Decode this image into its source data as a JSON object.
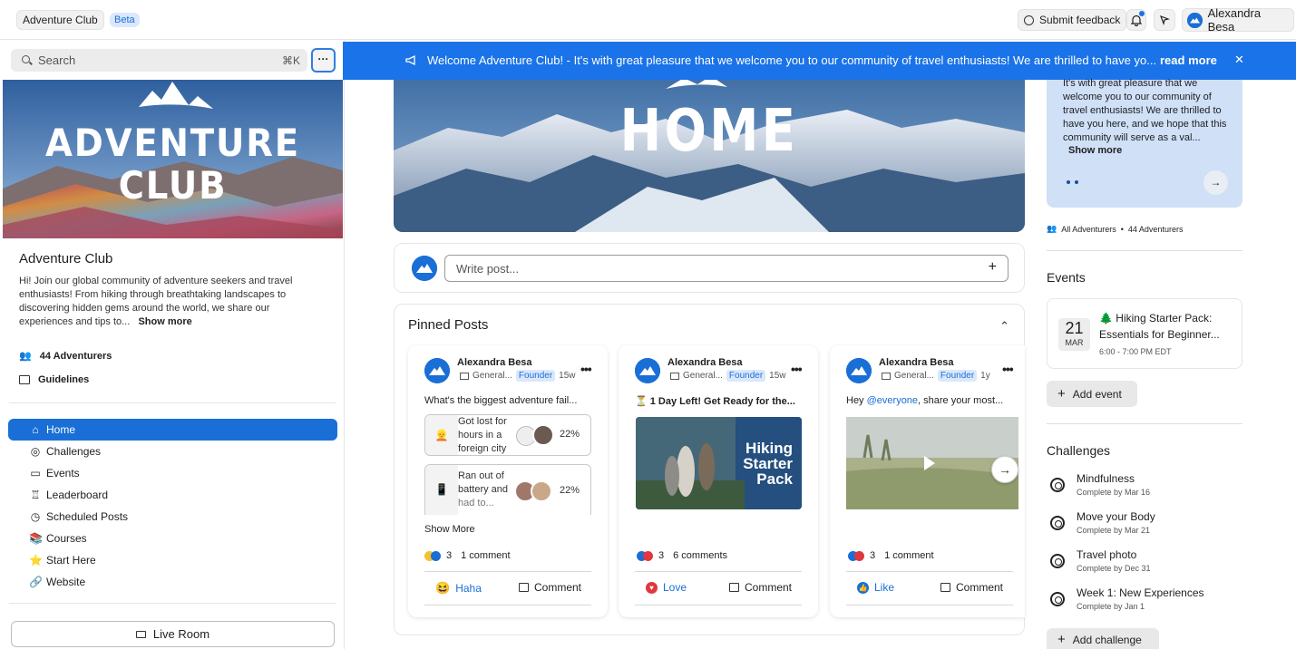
{
  "topbar": {
    "community": "Adventure Club",
    "beta": "Beta",
    "feedback": "Submit feedback",
    "user": "Alexandra Besa"
  },
  "sidebar": {
    "search_placeholder": "Search",
    "shortcut": "⌘K",
    "more": "···",
    "banner": {
      "line1": "ADVENTURE",
      "line2": "CLUB"
    },
    "title": "Adventure Club",
    "desc": "Hi! Join our global community of adventure seekers and travel enthusiasts! From hiking through breathtaking landscapes to discovering hidden gems around the world, we share our experiences and tips to...",
    "desc_l1": "Hi! Join our global community of adventure seekers and travel",
    "desc_l2": "enthusiasts! From hiking through breathtaking landscapes to",
    "desc_l3": "discovering hidden gems around the world, we share our",
    "desc_l4": "experiences and tips to...",
    "show_more": "Show more",
    "members": "44 Adventurers",
    "guidelines": "Guidelines",
    "nav": [
      {
        "label": "Home",
        "icon": "home-icon"
      },
      {
        "label": "Challenges",
        "icon": "target-icon"
      },
      {
        "label": "Events",
        "icon": "calendar-icon"
      },
      {
        "label": "Leaderboard",
        "icon": "trophy-icon"
      },
      {
        "label": "Scheduled Posts",
        "icon": "clock-icon"
      },
      {
        "label": "Courses",
        "icon": "books-icon"
      },
      {
        "label": "Start Here",
        "icon": "star-icon"
      },
      {
        "label": "Website",
        "icon": "link-icon"
      }
    ],
    "live_room": "Live Room"
  },
  "announcement": {
    "icon": "megaphone-icon",
    "text": "Welcome Adventure Club! - It's with great pleasure that we welcome you to our community of travel enthusiasts! We are thrilled to have yo...",
    "read_more": "read more",
    "close": "✕"
  },
  "hero": {
    "title": "HOME"
  },
  "composer": {
    "placeholder": "Write post...",
    "plus": "+"
  },
  "pinned": {
    "title": "Pinned Posts",
    "chevron": "⌃",
    "show_more": "Show More",
    "posts": [
      {
        "author": "Alexandra Besa",
        "space": "General...",
        "badge": "Founder",
        "age": "15w",
        "text": "What's the biggest adventure fail...",
        "options": [
          {
            "text": "Got lost for hours in a foreign city",
            "l1": "Got lost for",
            "l2": "hours in a",
            "l3": "foreign city",
            "pct": "22%",
            "emoji": "👱"
          },
          {
            "text": "Ran out of battery and had to...",
            "l1": "Ran out of",
            "l2": "battery and",
            "l3": "had to...",
            "pct": "22%",
            "emoji": "📱"
          }
        ],
        "reactions": "3",
        "comments": "1 comment",
        "action1": "Haha",
        "action2": "Comment"
      },
      {
        "author": "Alexandra Besa",
        "space": "General...",
        "badge": "Founder",
        "age": "15w",
        "text": "⏳ 1 Day Left! Get Ready for the...",
        "image_text": "Hiking Starter Pack",
        "img_l1": "Hiking",
        "img_l2": "Starter",
        "img_l3": "Pack",
        "reactions": "3",
        "comments": "6 comments",
        "action1": "Love",
        "action2": "Comment"
      },
      {
        "author": "Alexandra Besa",
        "space": "General...",
        "badge": "Founder",
        "age": "1y",
        "text_pre": "Hey ",
        "mention": "@everyone",
        "text_post": ", share your most...",
        "reactions": "3",
        "comments": "1 comment",
        "action1": "Like",
        "action2": "Comment"
      }
    ]
  },
  "right": {
    "about_l1": "It's with great pleasure that we",
    "about_l2": "welcome you to our community of",
    "about_l3": "travel enthusiasts! We are thrilled to",
    "about_l4": "have you here, and we hope that this",
    "about_l5": "community will serve as a val...",
    "about_show_more": "Show more",
    "members_all": "All Adventurers",
    "members_count": "44 Adventurers",
    "events_title": "Events",
    "event": {
      "day": "21",
      "month": "MAR",
      "title_l1": "🌲 Hiking Starter Pack:",
      "title_l2": "Essentials for Beginner...",
      "time": "6:00 - 7:00 PM EDT"
    },
    "add_event": "Add event",
    "challenges_title": "Challenges",
    "challenges": [
      {
        "title": "Mindfulness",
        "sub": "Complete by Mar 16"
      },
      {
        "title": "Move your Body",
        "sub": "Complete by Mar 21"
      },
      {
        "title": "Travel photo",
        "sub": "Complete by Dec 31"
      },
      {
        "title": "Week 1: New Experiences",
        "sub": "Complete by Jan 1"
      }
    ],
    "add_challenge": "Add challenge"
  },
  "colors": {
    "accent": "#1a6fd6",
    "banner": "#1a73e8",
    "nav_active": "#1a6fd6"
  }
}
